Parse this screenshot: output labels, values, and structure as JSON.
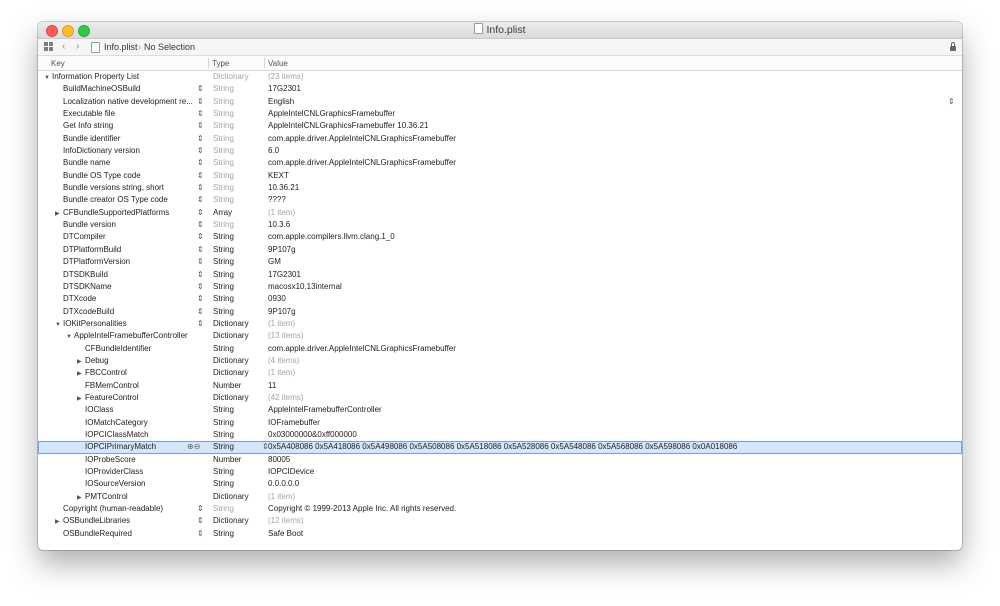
{
  "window": {
    "title": "Info.plist"
  },
  "jumpbar": {
    "file": "Info.plist",
    "selection": "No Selection"
  },
  "columns": {
    "key": "Key",
    "type": "Type",
    "value": "Value"
  },
  "rows": [
    {
      "k": "Information Property List",
      "t": "Dictionary",
      "v": "(23 items)",
      "indent": 0,
      "tri": "down",
      "dimType": true,
      "dimVal": true
    },
    {
      "k": "BuildMachineOSBuild",
      "t": "String",
      "v": "17G2301",
      "indent": 1,
      "step": true,
      "dimType": true
    },
    {
      "k": "Localization native development re...",
      "t": "String",
      "v": "English",
      "indent": 1,
      "step": true,
      "dimType": true,
      "rstep": true
    },
    {
      "k": "Executable file",
      "t": "String",
      "v": "AppleIntelCNLGraphicsFramebuffer",
      "indent": 1,
      "step": true,
      "dimType": true
    },
    {
      "k": "Get Info string",
      "t": "String",
      "v": "AppleIntelCNLGraphicsFramebuffer 10.36.21",
      "indent": 1,
      "step": true,
      "dimType": true
    },
    {
      "k": "Bundle identifier",
      "t": "String",
      "v": "com.apple.driver.AppleIntelCNLGraphicsFramebuffer",
      "indent": 1,
      "step": true,
      "dimType": true
    },
    {
      "k": "InfoDictionary version",
      "t": "String",
      "v": "6.0",
      "indent": 1,
      "step": true,
      "dimType": true
    },
    {
      "k": "Bundle name",
      "t": "String",
      "v": "com.apple.driver.AppleIntelCNLGraphicsFramebuffer",
      "indent": 1,
      "step": true,
      "dimType": true
    },
    {
      "k": "Bundle OS Type code",
      "t": "String",
      "v": "KEXT",
      "indent": 1,
      "step": true,
      "dimType": true
    },
    {
      "k": "Bundle versions string, short",
      "t": "String",
      "v": "10.36.21",
      "indent": 1,
      "step": true,
      "dimType": true
    },
    {
      "k": "Bundle creator OS Type code",
      "t": "String",
      "v": "????",
      "indent": 1,
      "step": true,
      "dimType": true
    },
    {
      "k": "CFBundleSupportedPlatforms",
      "t": "Array",
      "v": "(1 item)",
      "indent": 1,
      "tri": "right",
      "step": true,
      "dimVal": true
    },
    {
      "k": "Bundle version",
      "t": "String",
      "v": "10.3.6",
      "indent": 1,
      "step": true,
      "dimType": true
    },
    {
      "k": "DTCompiler",
      "t": "String",
      "v": "com.apple.compilers.llvm.clang.1_0",
      "indent": 1,
      "step": true
    },
    {
      "k": "DTPlatformBuild",
      "t": "String",
      "v": "9P107g",
      "indent": 1,
      "step": true
    },
    {
      "k": "DTPlatformVersion",
      "t": "String",
      "v": "GM",
      "indent": 1,
      "step": true
    },
    {
      "k": "DTSDKBuild",
      "t": "String",
      "v": "17G2301",
      "indent": 1,
      "step": true
    },
    {
      "k": "DTSDKName",
      "t": "String",
      "v": "macosx10.13internal",
      "indent": 1,
      "step": true
    },
    {
      "k": "DTXcode",
      "t": "String",
      "v": "0930",
      "indent": 1,
      "step": true
    },
    {
      "k": "DTXcodeBuild",
      "t": "String",
      "v": "9P107g",
      "indent": 1,
      "step": true
    },
    {
      "k": "IOKitPersonalities",
      "t": "Dictionary",
      "v": "(1 item)",
      "indent": 1,
      "tri": "down",
      "step": true,
      "dimVal": true
    },
    {
      "k": "AppleIntelFramebufferController",
      "t": "Dictionary",
      "v": "(13 items)",
      "indent": 2,
      "tri": "down",
      "dimVal": true
    },
    {
      "k": "CFBundleIdentifier",
      "t": "String",
      "v": "com.apple.driver.AppleIntelCNLGraphicsFramebuffer",
      "indent": 3
    },
    {
      "k": "Debug",
      "t": "Dictionary",
      "v": "(4 items)",
      "indent": 3,
      "tri": "right",
      "dimVal": true
    },
    {
      "k": "FBCControl",
      "t": "Dictionary",
      "v": "(1 item)",
      "indent": 3,
      "tri": "right",
      "dimVal": true
    },
    {
      "k": "FBMemControl",
      "t": "Number",
      "v": "11",
      "indent": 3
    },
    {
      "k": "FeatureControl",
      "t": "Dictionary",
      "v": "(42 items)",
      "indent": 3,
      "tri": "right",
      "dimVal": true
    },
    {
      "k": "IOClass",
      "t": "String",
      "v": "AppleIntelFramebufferController",
      "indent": 3
    },
    {
      "k": "IOMatchCategory",
      "t": "String",
      "v": "IOFramebuffer",
      "indent": 3
    },
    {
      "k": "IOPCIClassMatch",
      "t": "String",
      "v": "0x03000000&0xff000000",
      "indent": 3
    },
    {
      "k": "IOPCIPrimaryMatch",
      "t": "String",
      "v": "0x5A408086 0x5A418086 0x5A498086 0x5A508086 0x5A518086 0x5A528086 0x5A548086 0x5A568086 0x5A598086 0x0A018086",
      "indent": 3,
      "selected": true
    },
    {
      "k": "IOProbeScore",
      "t": "Number",
      "v": "80005",
      "indent": 3
    },
    {
      "k": "IOProviderClass",
      "t": "String",
      "v": "IOPCIDevice",
      "indent": 3
    },
    {
      "k": "IOSourceVersion",
      "t": "String",
      "v": "0.0.0.0.0",
      "indent": 3
    },
    {
      "k": "PMTControl",
      "t": "Dictionary",
      "v": "(1 item)",
      "indent": 3,
      "tri": "right",
      "dimVal": true
    },
    {
      "k": "Copyright (human-readable)",
      "t": "String",
      "v": "Copyright © 1999-2013 Apple Inc. All rights reserved.",
      "indent": 1,
      "step": true,
      "dimType": true
    },
    {
      "k": "OSBundleLibraries",
      "t": "Dictionary",
      "v": "(12 items)",
      "indent": 1,
      "tri": "right",
      "step": true,
      "dimVal": true
    },
    {
      "k": "OSBundleRequired",
      "t": "String",
      "v": "Safe Boot",
      "indent": 1,
      "step": true
    }
  ]
}
